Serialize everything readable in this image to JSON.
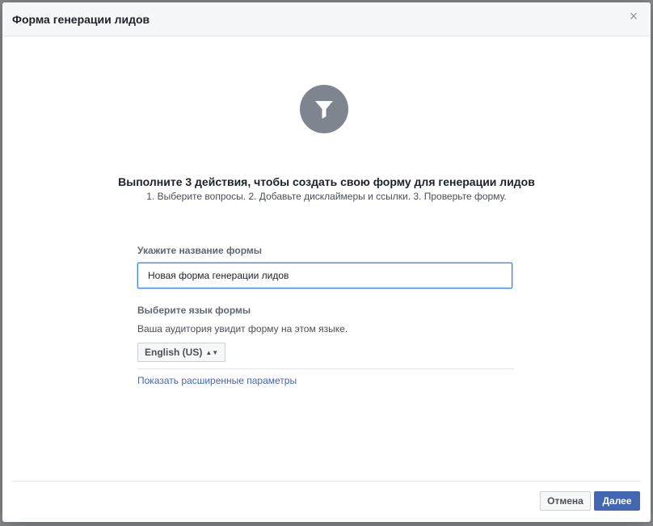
{
  "dialog": {
    "title": "Форма генерации лидов",
    "close_icon": "close-icon"
  },
  "hero": {
    "icon": "funnel-filter-icon",
    "heading": "Выполните 3 действия, чтобы создать свою форму для генерации лидов",
    "subheading": "1. Выберите вопросы. 2. Добавьте дисклаймеры и ссылки. 3. Проверьте форму."
  },
  "form": {
    "name_label": "Укажите название формы",
    "name_value": "Новая форма генерации лидов",
    "lang_label": "Выберите язык формы",
    "lang_desc": "Ваша аудитория увидит форму на этом языке.",
    "lang_value": "English (US)",
    "advanced_link": "Показать расширенные параметры"
  },
  "footer": {
    "cancel_label": "Отмена",
    "next_label": "Далее"
  },
  "colors": {
    "accent": "#4267b2",
    "focus_border": "#4080ff",
    "icon_bg": "#7f858f"
  }
}
